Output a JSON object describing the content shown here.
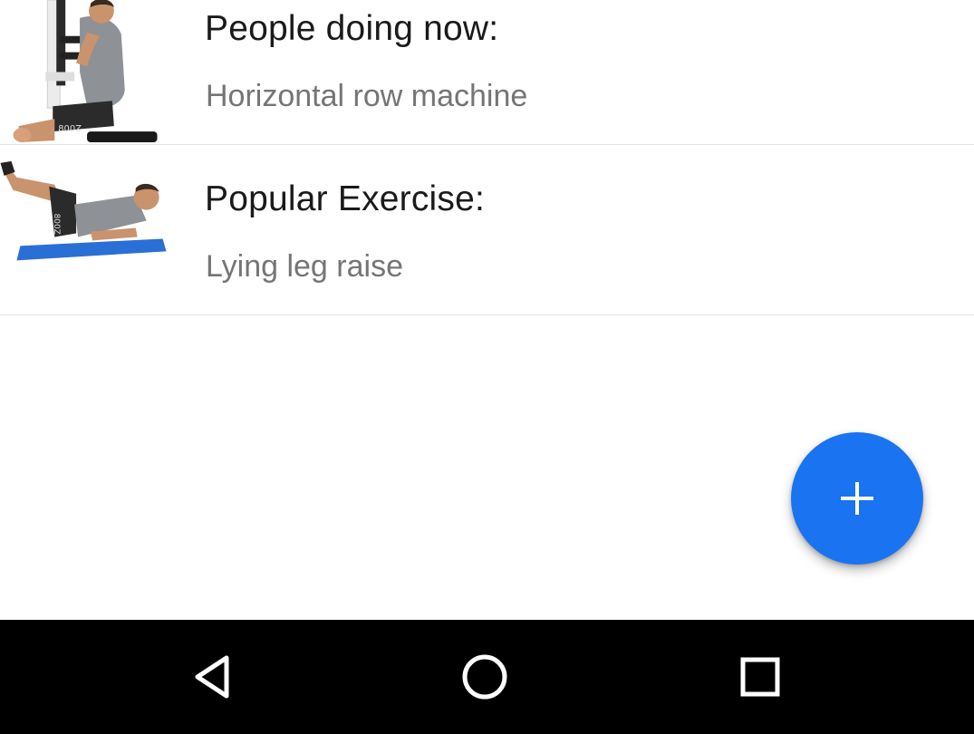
{
  "list": {
    "items": [
      {
        "title": "People doing now:",
        "subtitle": "Horizontal row machine",
        "icon": "row-machine-illustration"
      },
      {
        "title": "Popular Exercise:",
        "subtitle": "Lying leg raise",
        "icon": "leg-raise-illustration"
      }
    ]
  },
  "fab": {
    "icon": "plus-icon",
    "color": "#1a73f0"
  },
  "navbar": {
    "back_icon": "back-triangle-icon",
    "home_icon": "home-circle-icon",
    "recent_icon": "recent-apps-square-icon"
  }
}
